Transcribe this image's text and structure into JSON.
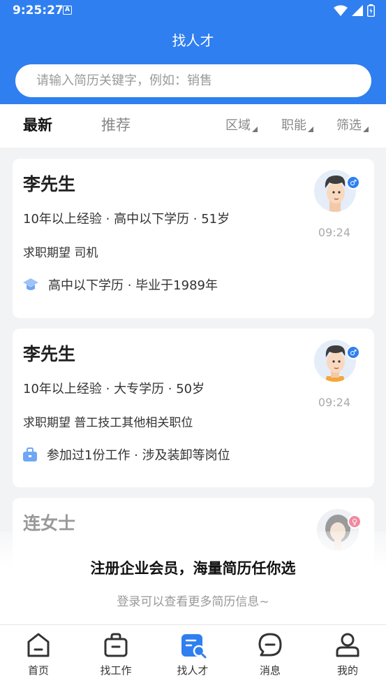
{
  "status_bar": {
    "time": "9:25:27",
    "badge": "A"
  },
  "header": {
    "title": "找人才"
  },
  "search": {
    "placeholder": "请输入简历关键字，例如：销售"
  },
  "tabs": [
    {
      "label": "最新",
      "active": true
    },
    {
      "label": "推荐",
      "active": false
    }
  ],
  "filters": [
    {
      "label": "区域"
    },
    {
      "label": "职能"
    },
    {
      "label": "筛选"
    }
  ],
  "candidates": [
    {
      "name": "李先生",
      "meta": "10年以上经验 · 高中以下学历 · 51岁",
      "expectation": "求职期望 司机",
      "extra": "高中以下学历 · 毕业于1989年",
      "extra_icon": "graduation-cap-icon",
      "time": "09:24",
      "gender": "♂"
    },
    {
      "name": "李先生",
      "meta": "10年以上经验 · 大专学历 · 50岁",
      "expectation": "求职期望 普工技工其他相关职位",
      "extra": "参加过1份工作 · 涉及装卸等岗位",
      "extra_icon": "briefcase-icon",
      "time": "09:24",
      "gender": "♂"
    },
    {
      "name": "连女士",
      "gender": "♀"
    }
  ],
  "promo": {
    "title": "注册企业会员，海量简历任你选",
    "subtitle": "登录可以查看更多简历信息~"
  },
  "bottom_nav": [
    {
      "label": "首页",
      "icon": "home-icon"
    },
    {
      "label": "找工作",
      "icon": "briefcase-icon"
    },
    {
      "label": "找人才",
      "icon": "talent-search-icon",
      "active": true
    },
    {
      "label": "消息",
      "icon": "message-icon"
    },
    {
      "label": "我的",
      "icon": "user-icon"
    }
  ],
  "colors": {
    "primary": "#2f7ff0",
    "male": "#2f7ff0",
    "female": "#f08aa0"
  }
}
